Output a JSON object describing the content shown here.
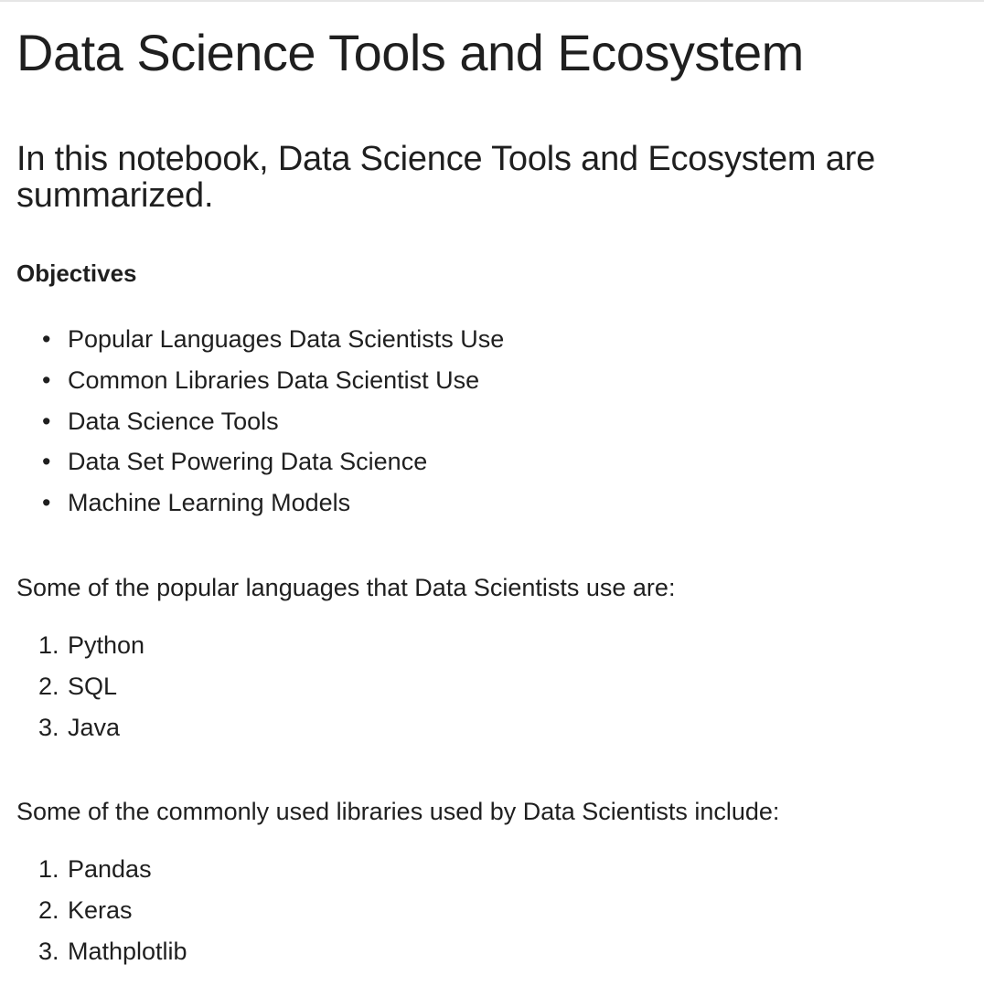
{
  "title": "Data Science Tools and Ecosystem",
  "intro": "In this notebook, Data Science Tools and Ecosystem are summarized.",
  "objectives": {
    "heading": "Objectives",
    "items": [
      "Popular Languages Data Scientists Use",
      "Common Libraries Data Scientist Use",
      "Data Science Tools",
      "Data Set Powering Data Science",
      "Machine Learning Models"
    ]
  },
  "languages": {
    "intro": "Some of the popular languages that Data Scientists use are:",
    "items": [
      {
        "num": "1.",
        "label": "Python"
      },
      {
        "num": "2.",
        "label": "SQL"
      },
      {
        "num": "3.",
        "label": "Java"
      }
    ]
  },
  "libraries": {
    "intro": "Some of the commonly used libraries used by Data Scientists include:",
    "items": [
      {
        "num": "1.",
        "label": "Pandas"
      },
      {
        "num": "2.",
        "label": "Keras"
      },
      {
        "num": "3.",
        "label": "Mathplotlib"
      }
    ]
  }
}
